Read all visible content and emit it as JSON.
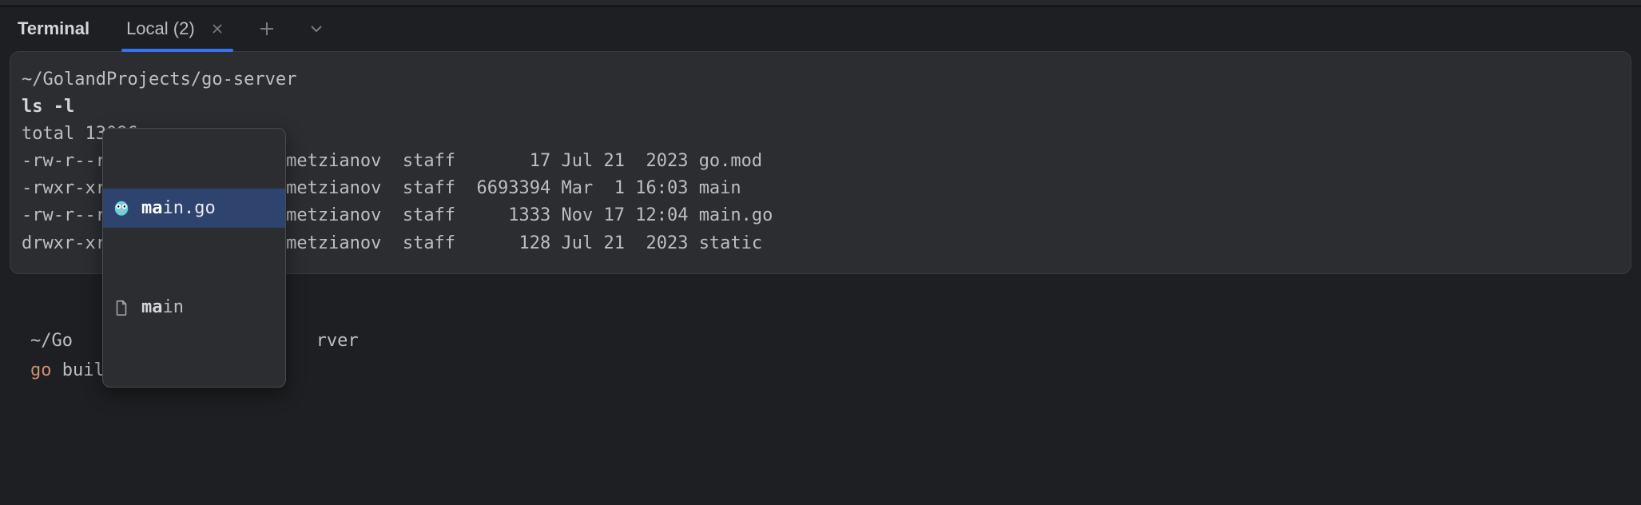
{
  "title": "Terminal",
  "tab": {
    "label": "Local (2)"
  },
  "output": {
    "cwd": "~/GolandProjects/go-server",
    "cmd": "ls -l",
    "total": "total 13096",
    "lines": [
      "-rw-r--r--   1 Ruslan.Akhmetzianov  staff       17 Jul 21  2023 go.mod",
      "-rwxr-xr-x   1 Ruslan.Akhmetzianov  staff  6693394 Mar  1 16:03 main",
      "-rw-r--r--@  1 Ruslan.Akhmetzianov  staff     1333 Nov 17 12:04 main.go",
      "drwxr-xr-x   4 Ruslan.Akhmetzianov  staff      128 Jul 21  2023 static"
    ]
  },
  "prompt": {
    "cwd_before": "~/Go",
    "cwd_after": "rver",
    "cmd_word": "go",
    "typed_rest": " build ma",
    "ghost": "in.go"
  },
  "completion": {
    "items": [
      {
        "match": "ma",
        "rest": "in.go",
        "icon": "gopher"
      },
      {
        "match": "ma",
        "rest": "in",
        "icon": "file"
      }
    ]
  }
}
